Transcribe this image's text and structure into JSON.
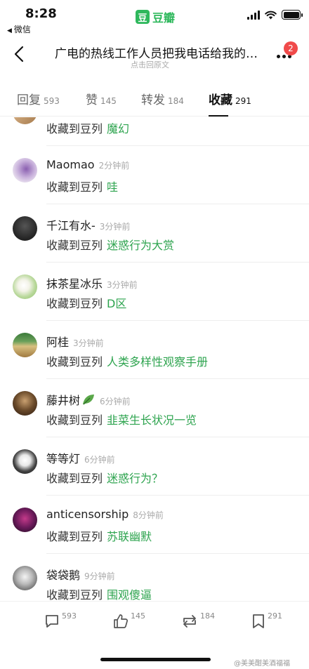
{
  "status_bar": {
    "time": "8:28",
    "back_app": "微信",
    "brand_logo": "豆",
    "brand_name": "豆瓣"
  },
  "header": {
    "title": "广电的热线工作人员把我电话给我的领导，...",
    "subtitle": "点击回原文",
    "badge_count": "2"
  },
  "tabs": [
    {
      "label": "回复",
      "count": "593"
    },
    {
      "label": "赞",
      "count": "145"
    },
    {
      "label": "转发",
      "count": "184"
    },
    {
      "label": "收藏",
      "count": "291",
      "active": true
    }
  ],
  "entries": [
    {
      "user": "",
      "time": "",
      "action": "收藏到豆列",
      "doulist": "魔幻"
    },
    {
      "user": "Maomao",
      "time": "2分钟前",
      "action": "收藏到豆列",
      "doulist": "哇"
    },
    {
      "user": "千江有水-",
      "time": "3分钟前",
      "action": "收藏到豆列",
      "doulist": "迷惑行为大赏"
    },
    {
      "user": "抹茶星冰乐",
      "time": "3分钟前",
      "action": "收藏到豆列",
      "doulist": "D区"
    },
    {
      "user": "阿桂",
      "time": "3分钟前",
      "action": "收藏到豆列",
      "doulist": "人类多样性观察手册"
    },
    {
      "user": "藤井树",
      "time": "6分钟前",
      "action": "收藏到豆列",
      "doulist": "韭菜生长状况一览"
    },
    {
      "user": "等等灯",
      "time": "6分钟前",
      "action": "收藏到豆列",
      "doulist": "迷惑行为？"
    },
    {
      "user": "anticensorship",
      "time": "8分钟前",
      "action": "收藏到豆列",
      "doulist": "苏联幽默"
    },
    {
      "user": "袋袋鹅",
      "time": "9分钟前",
      "action": "收藏到豆列",
      "doulist": "围观傻逼"
    }
  ],
  "bottom_bar": {
    "reply_count": "593",
    "like_count": "145",
    "repost_count": "184",
    "collect_count": "291"
  },
  "watermark": "@美美酣美酒福福",
  "colors": {
    "accent_green": "#2ea44f",
    "badge_red": "#f04a4a"
  }
}
